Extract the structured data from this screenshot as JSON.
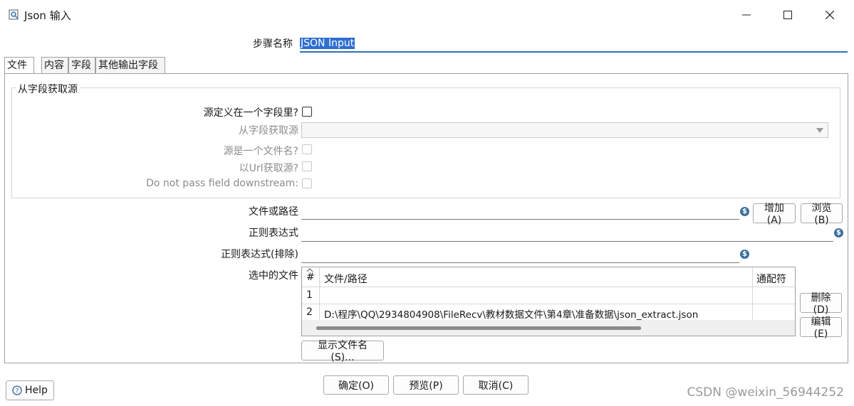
{
  "window": {
    "title": "Json 输入",
    "controls": [
      "minimize",
      "maximize",
      "close"
    ]
  },
  "step": {
    "label": "步骤名称",
    "value": "JSON Input"
  },
  "tabs": [
    {
      "label": "文件",
      "active": true
    },
    {
      "label": "内容",
      "active": false
    },
    {
      "label": "字段",
      "active": false
    },
    {
      "label": "其他输出字段",
      "active": false
    }
  ],
  "group": {
    "title": "从字段获取源",
    "source_in_field_label": "源定义在一个字段里?",
    "source_from_field_label": "从字段获取源",
    "source_is_filename_label": "源是一个文件名?",
    "source_from_url_label": "以Url获取源?",
    "do_not_pass_label": "Do not pass field downstream:"
  },
  "file": {
    "path_label": "文件或路径",
    "regex_label": "正则表达式",
    "regex_exclude_label": "正则表达式(排除)",
    "selected_label": "选中的文件",
    "add_button": "增加(A)",
    "browse_button": "浏览(B)",
    "delete_button": "删除(D)",
    "edit_button": "编辑(E)",
    "show_filenames_button": "显示文件名(S)..."
  },
  "table": {
    "columns": [
      "#",
      "文件/路径",
      "通配符"
    ],
    "rows": [
      {
        "num": "1",
        "path": "",
        "wildcard": ""
      },
      {
        "num": "2",
        "path": "D:\\程序\\QQ\\2934804908\\FileRecv\\教材数据文件\\第4章\\准备数据\\json_extract.json",
        "wildcard": ""
      }
    ]
  },
  "footer": {
    "help": "Help",
    "ok": "确定(O)",
    "preview": "预览(P)",
    "cancel": "取消(C)"
  },
  "watermark": "CSDN @weixin_56944252",
  "colors": {
    "accent": "#2f6fd0",
    "variable_icon": "#3b6f9c"
  }
}
